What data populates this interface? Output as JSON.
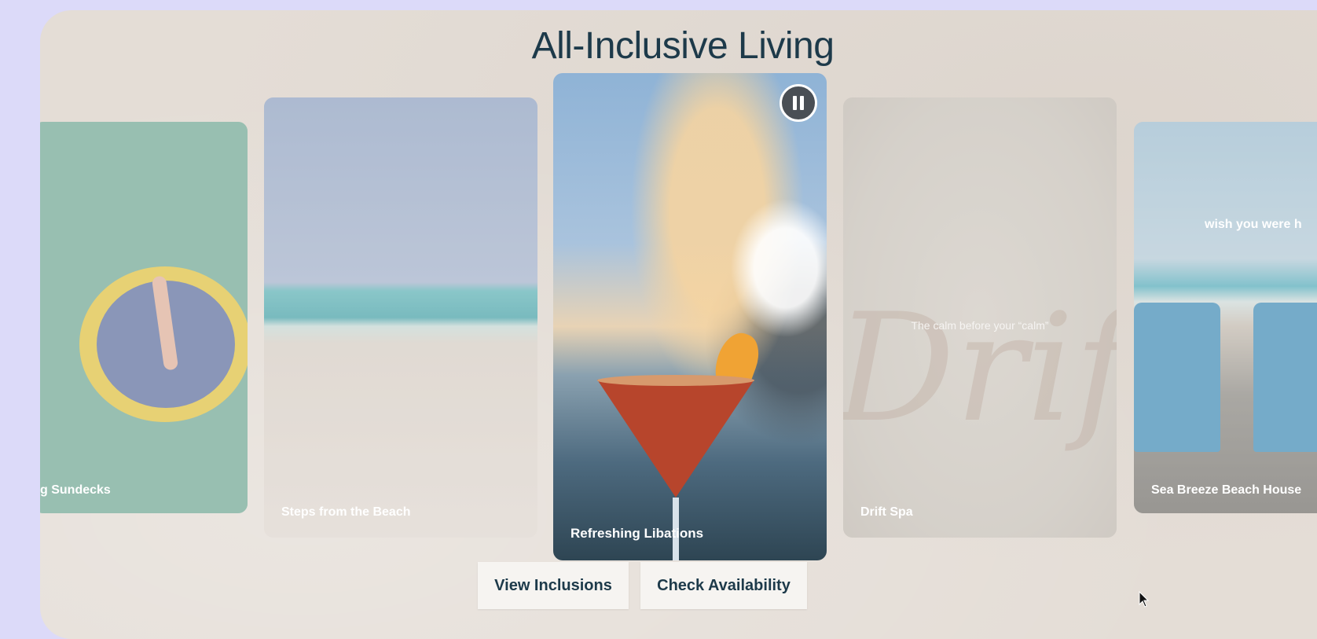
{
  "section": {
    "title": "All-Inclusive Living"
  },
  "carousel": {
    "cards": [
      {
        "caption": "g Sundecks"
      },
      {
        "caption": "Steps from the Beach"
      },
      {
        "caption": "Refreshing Libations"
      },
      {
        "caption": "Drift Spa",
        "tagline": "The calm before your “calm”",
        "script_text": "Drift"
      },
      {
        "caption": "Sea Breeze Beach House",
        "overlay_text": "wish you were h"
      }
    ],
    "pause_icon": "pause-icon"
  },
  "actions": {
    "view_inclusions": "View Inclusions",
    "check_availability": "Check Availability"
  },
  "colors": {
    "page_background": "#dcdaf9",
    "panel_background": "#e4ddd6",
    "title_color": "#1d3a4a",
    "button_background": "#f6f4f1"
  },
  "icons": {
    "cursor": "mouse-pointer-icon"
  }
}
